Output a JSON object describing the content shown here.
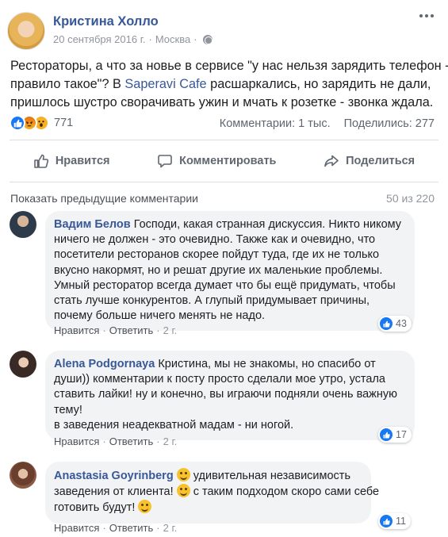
{
  "post": {
    "author": "Кристина Холло",
    "date": "20 сентября 2016 г.",
    "separator": "·",
    "location": "Москва",
    "text_lines": [
      "Рестораторы, а что за новье в сервисе \"у нас нельзя зарядить телефон -",
      "правило такое\"? В ",
      "Saperavi Cafe",
      " расшаркались, но зарядить не дали,",
      "пришлось шустро сворачивать ужин и мчать к розетке - звонка ждала."
    ],
    "reactions_count": "771",
    "comments_stat": "Комментарии: 1 тыс.",
    "shares_stat": "Поделились: 277"
  },
  "actions": {
    "like": "Нравится",
    "comment": "Комментировать",
    "share": "Поделиться"
  },
  "comments_header": {
    "show_previous": "Показать предыдущие комментарии",
    "count": "50 из 220"
  },
  "comments": [
    {
      "name": "Вадим Белов",
      "lines": [
        " Господи, какая странная дискуссия. Никто никому",
        "ничего не должен - это очевидно. Также как и очевидно, что",
        "посетители ресторанов скорее пойдут туда, где их не только",
        "вкусно накормят, но и решат другие их маленькие проблемы.",
        "Умный ресторатор всегда думает что бы ещё придумать, чтобы",
        "стать лучше конкурентов. А глупый придумывает причины,",
        "почему больше ничего менять не надо."
      ],
      "like": "Нравится",
      "reply": "Ответить",
      "time": "2 г.",
      "dot": "·",
      "likes": "43"
    },
    {
      "name": "Alena Podgornaya",
      "lines": [
        " Кристина, мы не знакомы, но спасибо от",
        "души)) комментарии к посту просто сделали мое утро, устала",
        "ставить лайки! ну и конечно, вы играючи подняли очень важную",
        "тему!",
        "в заведения неадекватной мадам - ни ногой."
      ],
      "like": "Нравится",
      "reply": "Ответить",
      "time": "2 г.",
      "dot": "·",
      "likes": "17"
    },
    {
      "name": "Anastasia Goyrinberg",
      "lines": [
        " удивительная независимость",
        "заведения от клиента! ",
        " с таким подходом скоро сами себе",
        "готовить будут! "
      ],
      "like": "Нравится",
      "reply": "Ответить",
      "time": "2 г.",
      "dot": "·",
      "likes": "11"
    }
  ],
  "icons": {
    "reactions": [
      "like-icon",
      "angry-icon",
      "wow-icon"
    ],
    "actions": [
      "thumbs-up-icon",
      "comment-bubble-icon",
      "share-arrow-icon"
    ]
  },
  "colors": {
    "link": "#385898",
    "like_blue": "#1877f2",
    "bubble": "#f2f3f5"
  }
}
